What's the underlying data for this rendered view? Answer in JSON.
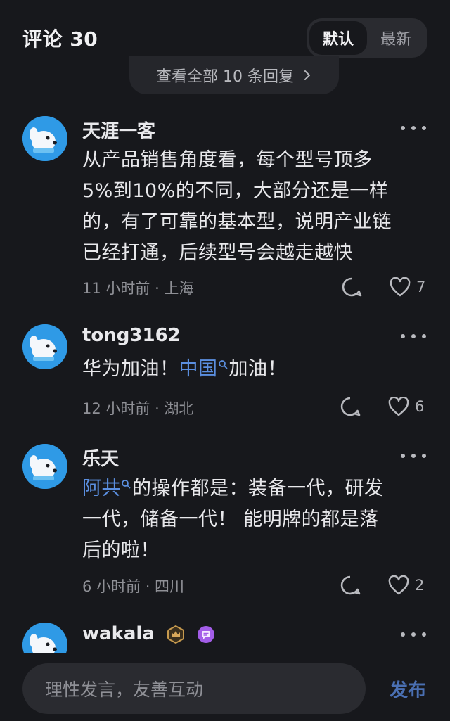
{
  "header": {
    "title": "评论 30",
    "sort_options": [
      "默认",
      "最新"
    ],
    "active_sort": "默认"
  },
  "view_all_replies": "查看全部 10 条回复",
  "comments": [
    {
      "username": "天涯一客",
      "lines": [
        "从产品销售角度看，每个型号顶多",
        "5%到10%的不同，大部分还是一样",
        "的，有了可靠的基本型，说明产业链",
        "已经打通，后续型号会越走越快"
      ],
      "meta": "11 小时前 · 上海",
      "likes": "7"
    },
    {
      "username": "tong3162",
      "text_before": "华为加油！",
      "link": "中国",
      "text_after": "加油！",
      "meta": "12 小时前 · 湖北",
      "likes": "6"
    },
    {
      "username": "乐天",
      "link": "阿共",
      "line1_after": "的操作都是：装备一代，研发",
      "line2": "一代，储备一代！ 能明牌的都是落",
      "line3": "后的啦！",
      "meta": "6 小时前 · 四川",
      "likes": "2"
    },
    {
      "username": "wakala",
      "badges": [
        "crown-badge-icon",
        "chat-badge-icon"
      ]
    }
  ],
  "composer": {
    "placeholder": "理性发言，友善互动",
    "post_label": "发布"
  },
  "colors": {
    "background": "#17181c",
    "link": "#5b8fe0",
    "post_button": "#4a6fb2",
    "avatar": "#2f9ae6"
  }
}
